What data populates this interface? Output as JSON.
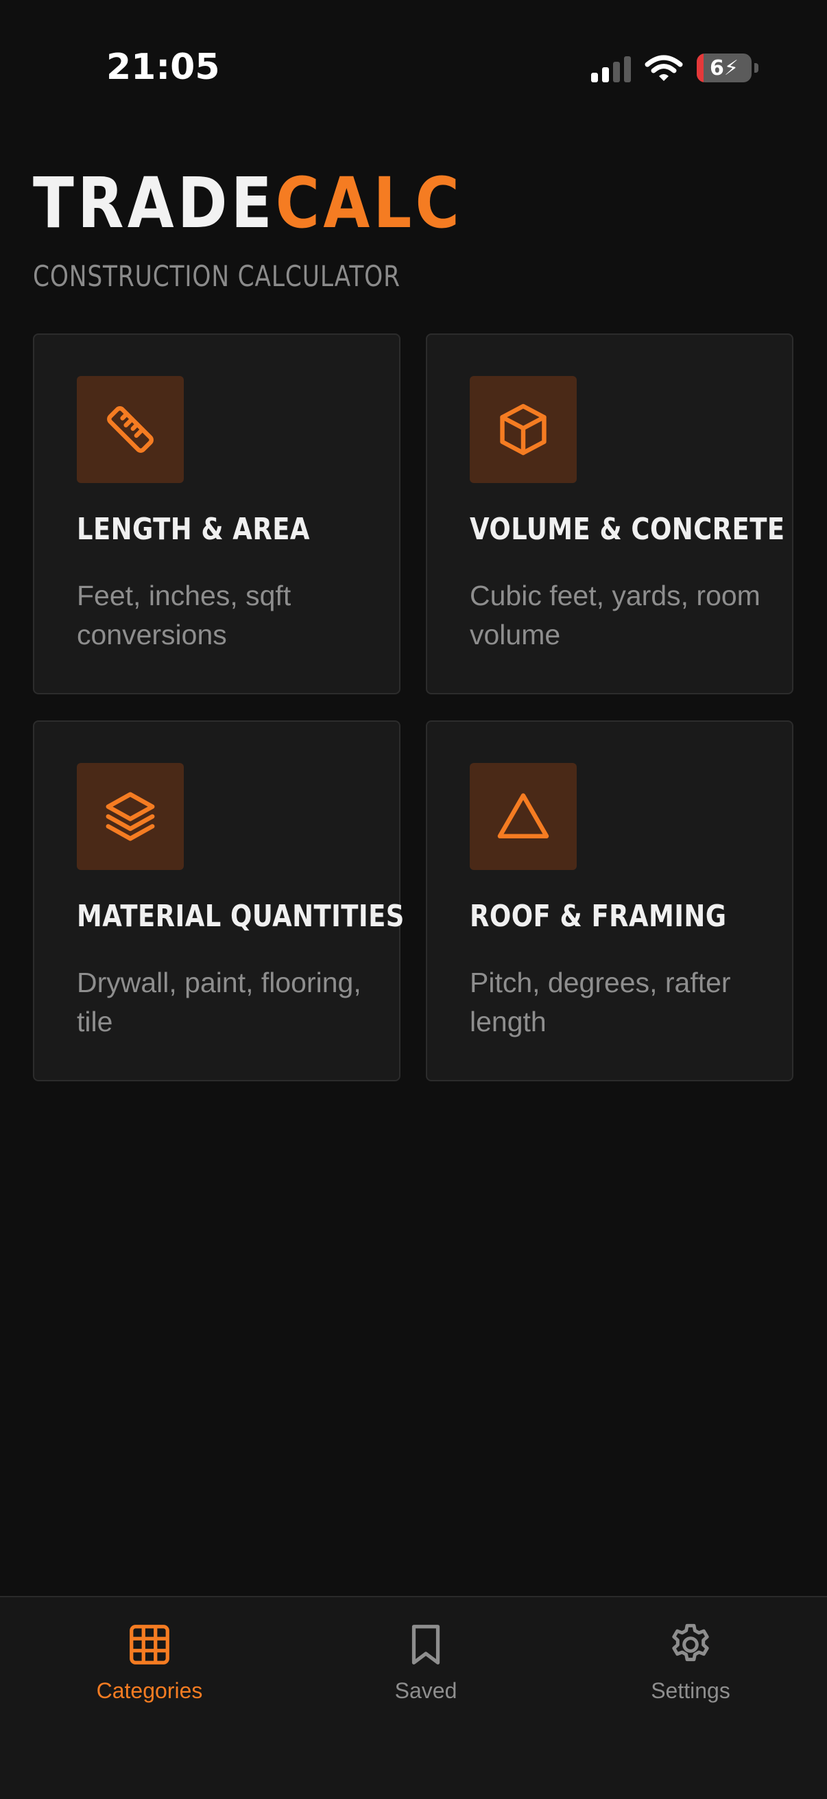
{
  "status_bar": {
    "time": "21:05",
    "battery": "6",
    "icons": [
      "cellular-signal-icon",
      "wifi-icon",
      "battery-charging-icon"
    ]
  },
  "header": {
    "brand_part1": "TRADE",
    "brand_part2": "CALC",
    "subtitle": "CONSTRUCTION CALCULATOR"
  },
  "colors": {
    "accent": "#f57c22",
    "background": "#0f0f0f",
    "card": "#1a1a1a",
    "icon_tile": "#4a2917"
  },
  "categories": [
    {
      "icon": "ruler-icon",
      "title": "LENGTH & AREA",
      "description": "Feet, inches, sqft conversions"
    },
    {
      "icon": "cube-icon",
      "title": "VOLUME & CONCRETE",
      "description": "Cubic feet, yards, room volume"
    },
    {
      "icon": "layers-icon",
      "title": "MATERIAL QUANTITIES",
      "description": "Drywall, paint, flooring, tile"
    },
    {
      "icon": "triangle-icon",
      "title": "ROOF & FRAMING",
      "description": "Pitch, degrees, rafter length"
    }
  ],
  "tabbar": {
    "tabs": [
      {
        "label": "Categories",
        "icon": "grid-icon",
        "active": true
      },
      {
        "label": "Saved",
        "icon": "bookmark-icon",
        "active": false
      },
      {
        "label": "Settings",
        "icon": "gear-icon",
        "active": false
      }
    ]
  }
}
